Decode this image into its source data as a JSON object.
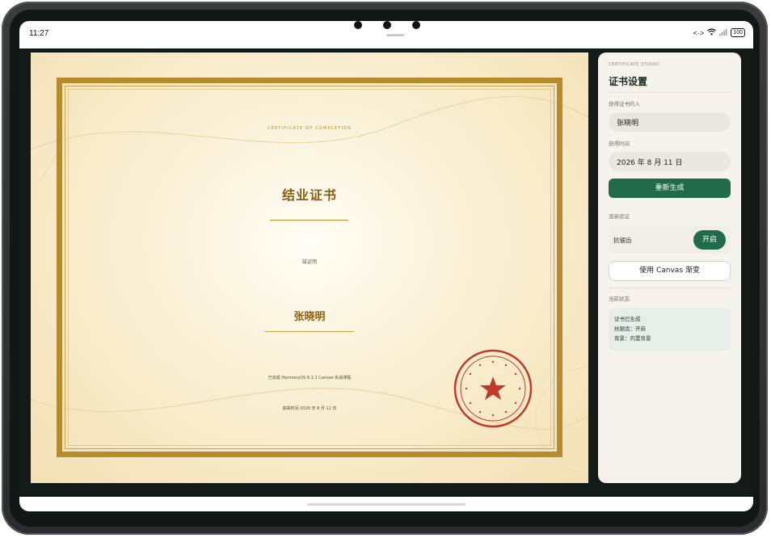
{
  "status_bar": {
    "time": "11:27",
    "code_icon": "<·>",
    "wifi_icon": "wifi-icon",
    "signal_icon": "signal-icon",
    "battery": "100"
  },
  "certificate": {
    "eyebrow": "CERTIFICATE OF COMPLETION",
    "title": "结业证书",
    "certify_text": "兹证明",
    "recipient": "张晓明",
    "course_text": "已完成 HarmonyOS 6.1.1 Canvas 实战课程",
    "date_text": "获得时间 2026 年 8 月 11 日",
    "colors": {
      "gold": "#b88a2e",
      "title": "#8b5e14",
      "seal": "#c0392b"
    }
  },
  "panel": {
    "eyebrow": "CERTIFICATE STUDIO",
    "title": "证书设置",
    "recipient_label": "获得证书的人",
    "recipient_value": "张晓明",
    "date_label": "获得时间",
    "date_value": "2026 年 8 月 11 日",
    "regenerate_button": "重新生成",
    "render_section_label": "渲染验证",
    "antialias_label": "抗锯齿",
    "antialias_toggle": "开启",
    "gradient_button": "使用 Canvas 渐变",
    "state_label": "当前状态",
    "state_lines": [
      "证书已生成",
      "抗锯齿：开启",
      "背景：内置背景"
    ],
    "colors": {
      "accent": "#1f6b4c",
      "panel_bg": "#f6f3ec"
    }
  }
}
